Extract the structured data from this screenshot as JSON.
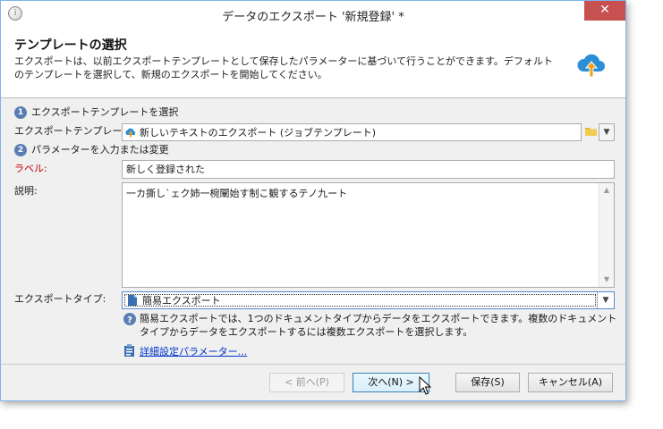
{
  "window": {
    "title": "データのエクスポート '新規登録' *",
    "close_glyph": "✕"
  },
  "header": {
    "title": "テンプレートの選択",
    "description": "エクスポートは、以前エクスポートテンプレートとして保存したパラメーターに基づいて行うことができます。デフォルトのテンプレートを選択して、新規のエクスポートを開始してください。",
    "icon": "cloud-upload-icon"
  },
  "step1": {
    "number": "1",
    "label": "エクスポートテンプレートを選択"
  },
  "template": {
    "label": "エクスポートテンプレート:",
    "value": "新しいテキストのエクスポート (ジョブテンプレート)"
  },
  "step2": {
    "number": "2",
    "label": "パラメーターを入力または変更"
  },
  "form": {
    "label_label": "ラベル:",
    "label_value": "新しく登録された",
    "description_label": "説明:",
    "description_value": "一カ撕し`ェク姉一椀闡始す制こ観するテノ九ート",
    "export_type_label": "エクスポートタイプ:",
    "export_type_value": "簡易エクスポート"
  },
  "help": {
    "text": "簡易エクスポートでは、1つのドキュメントタイプからデータをエクスポートできます。複数のドキュメントタイプからデータをエクスポートするには複数エクスポートを選択します。"
  },
  "advanced": {
    "link": "詳細設定パラメーター..."
  },
  "buttons": {
    "prev": "< 前へ(P)",
    "next": "次へ(N) >",
    "save": "保存(S)",
    "cancel": "キャンセル(A)"
  },
  "colors": {
    "close": "#c75050",
    "accent": "#5a7eb3",
    "required_label": "#c40000",
    "link": "#0033cc",
    "cloud": "#2c8fd6",
    "arrow": "#f2a11a"
  }
}
